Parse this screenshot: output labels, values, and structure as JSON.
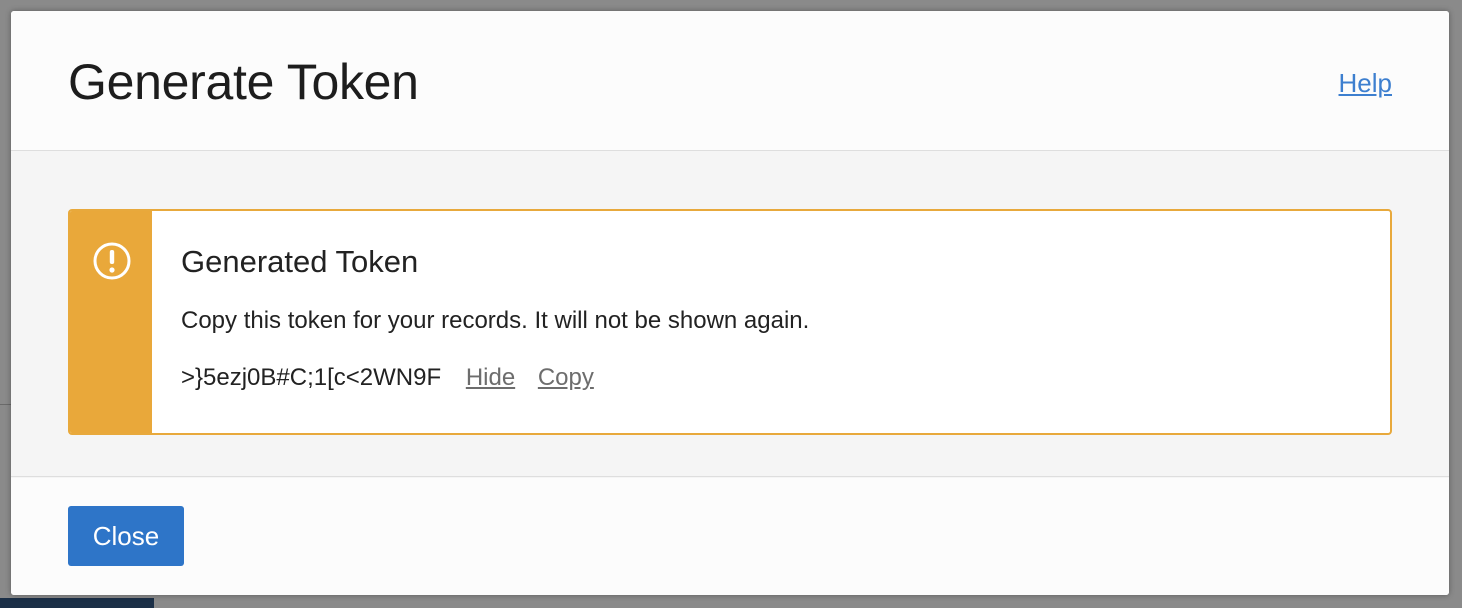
{
  "dialog": {
    "title": "Generate Token",
    "help_label": "Help"
  },
  "notice": {
    "icon": "warning-circle-icon",
    "title": "Generated Token",
    "message": "Copy this token for your records. It will not be shown again.",
    "token": ">}5ezj0B#C;1[c<2WN9F",
    "hide_label": "Hide",
    "copy_label": "Copy",
    "accent_color": "#e9a83a"
  },
  "footer": {
    "close_label": "Close",
    "button_color": "#2e75c8"
  }
}
